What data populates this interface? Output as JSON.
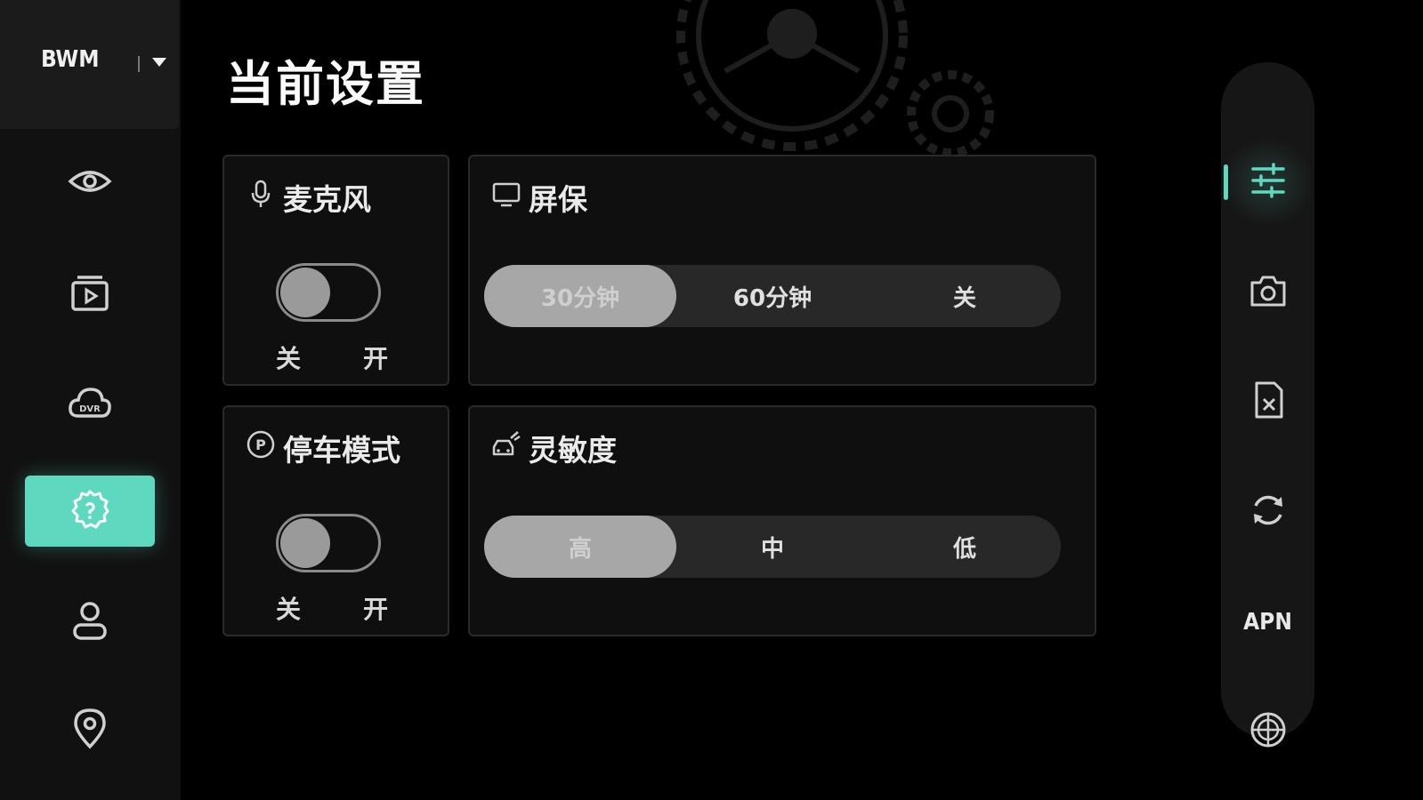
{
  "brand": {
    "name": "BWM"
  },
  "sidebar": {
    "items": [
      {
        "icon": "eye-icon",
        "active": false
      },
      {
        "icon": "video-folder-icon",
        "active": false
      },
      {
        "icon": "cloud-dvr-icon",
        "label": "DVR",
        "active": false
      },
      {
        "icon": "settings-gear-icon",
        "active": true
      },
      {
        "icon": "user-icon",
        "active": false
      },
      {
        "icon": "location-pin-icon",
        "active": false
      }
    ],
    "accent": "#5fd8c0"
  },
  "page": {
    "title": "当前设置"
  },
  "microphone": {
    "title": "麦克风",
    "off_label": "关",
    "on_label": "开",
    "state": "off"
  },
  "screensaver": {
    "title": "屏保",
    "options": [
      "30分钟",
      "60分钟",
      "关"
    ],
    "selected": "30分钟"
  },
  "parking_mode": {
    "title": "停车模式",
    "off_label": "关",
    "on_label": "开",
    "state": "off",
    "icon_letter": "P"
  },
  "sensitivity": {
    "title": "灵敏度",
    "options": [
      "高",
      "中",
      "低"
    ],
    "selected": "高"
  },
  "rail": {
    "items": [
      {
        "icon": "sliders-icon",
        "active": true
      },
      {
        "icon": "camera-icon",
        "active": false
      },
      {
        "icon": "sd-card-remove-icon",
        "active": false
      },
      {
        "icon": "refresh-icon",
        "active": false
      },
      {
        "label": "APN",
        "active": false
      },
      {
        "icon": "globe-icon",
        "active": false
      }
    ]
  }
}
